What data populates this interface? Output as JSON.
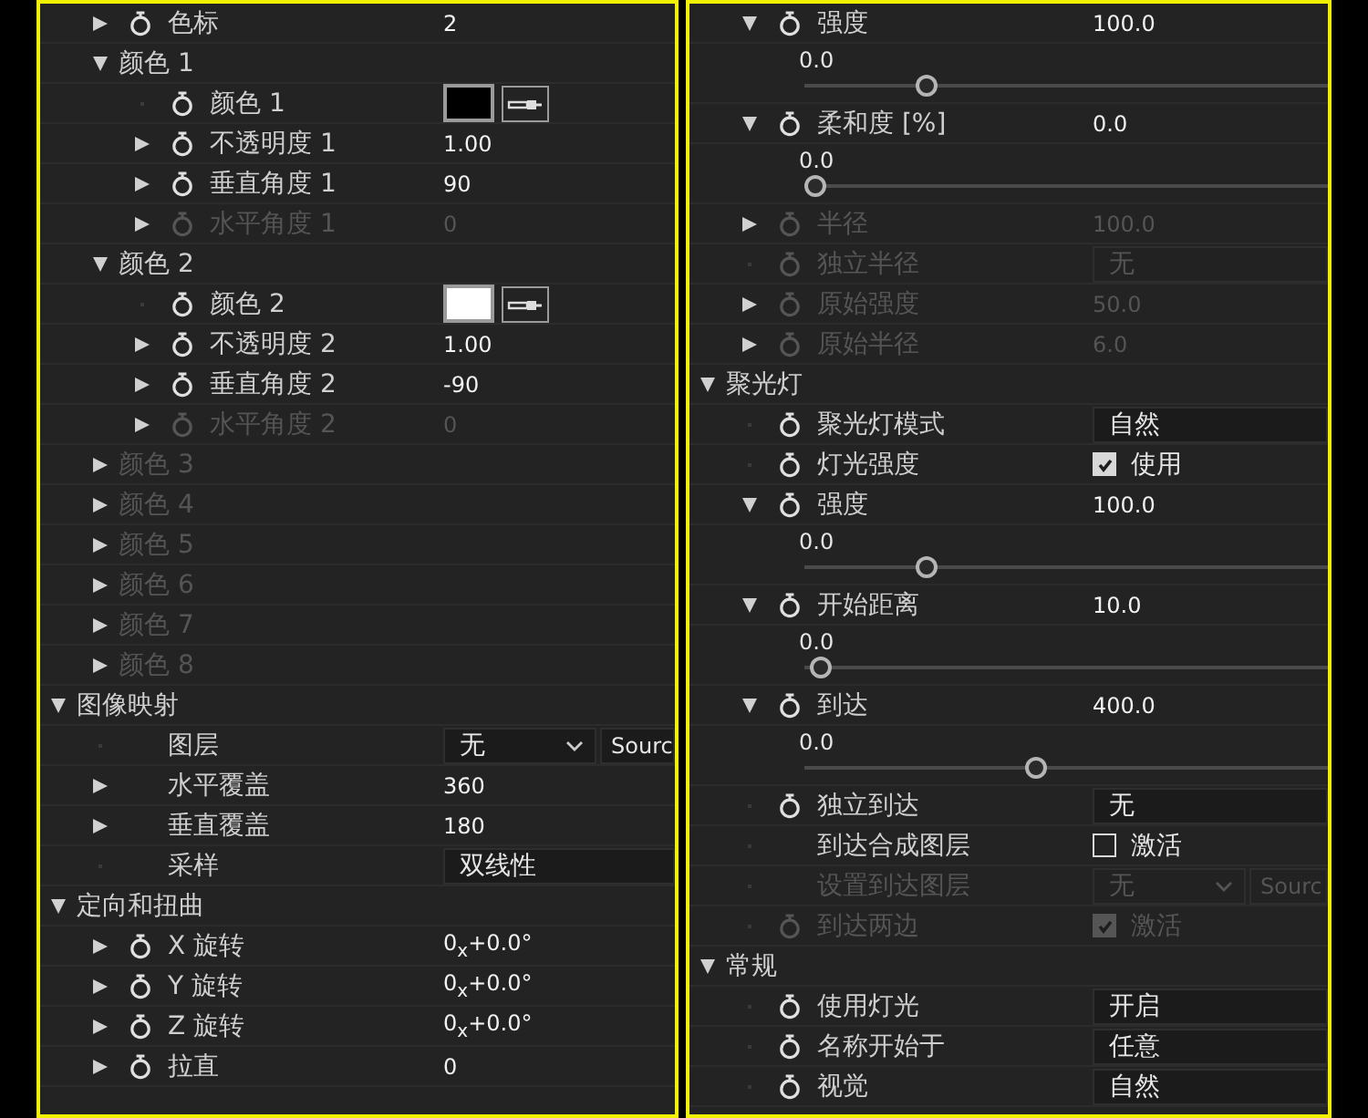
{
  "left": {
    "items": [
      {
        "children": [
          {
            "kind": "prop",
            "label": "色标",
            "value": "2",
            "stopwatch": true,
            "expanded": false,
            "disabled": false
          },
          {
            "kind": "group",
            "label": "颜色 1",
            "expanded": true,
            "disabled": false,
            "children": [
              {
                "kind": "color",
                "label": "颜色 1",
                "stopwatch": true,
                "color": "#000000",
                "disabled": false
              },
              {
                "kind": "prop",
                "label": "不透明度 1",
                "value": "1.00",
                "stopwatch": true,
                "expanded": false,
                "disabled": false
              },
              {
                "kind": "prop",
                "label": "垂直角度 1",
                "value": "90",
                "stopwatch": true,
                "expanded": false,
                "disabled": false
              },
              {
                "kind": "prop",
                "label": "水平角度 1",
                "value": "0",
                "stopwatch": true,
                "expanded": false,
                "disabled": true
              }
            ]
          },
          {
            "kind": "group",
            "label": "颜色 2",
            "expanded": true,
            "disabled": false,
            "children": [
              {
                "kind": "color",
                "label": "颜色 2",
                "stopwatch": true,
                "color": "#ffffff",
                "disabled": false
              },
              {
                "kind": "prop",
                "label": "不透明度 2",
                "value": "1.00",
                "stopwatch": true,
                "expanded": false,
                "disabled": false
              },
              {
                "kind": "prop",
                "label": "垂直角度 2",
                "value": "-90",
                "stopwatch": true,
                "expanded": false,
                "disabled": false
              },
              {
                "kind": "prop",
                "label": "水平角度 2",
                "value": "0",
                "stopwatch": true,
                "expanded": false,
                "disabled": true
              }
            ]
          },
          {
            "kind": "group",
            "label": "颜色 3",
            "expanded": false,
            "disabled": true
          },
          {
            "kind": "group",
            "label": "颜色 4",
            "expanded": false,
            "disabled": true
          },
          {
            "kind": "group",
            "label": "颜色 5",
            "expanded": false,
            "disabled": true
          },
          {
            "kind": "group",
            "label": "颜色 6",
            "expanded": false,
            "disabled": true
          },
          {
            "kind": "group",
            "label": "颜色 7",
            "expanded": false,
            "disabled": true
          },
          {
            "kind": "group",
            "label": "颜色 8",
            "expanded": false,
            "disabled": true
          }
        ]
      },
      {
        "kind": "group",
        "label": "图像映射",
        "expanded": true,
        "disabled": false,
        "children": [
          {
            "kind": "layer",
            "label": "图层",
            "value": "无",
            "source": "Sourc",
            "stopwatch": false,
            "disabled": false
          },
          {
            "kind": "prop",
            "label": "水平覆盖",
            "value": "360",
            "stopwatch": false,
            "expanded": false,
            "disabled": false
          },
          {
            "kind": "prop",
            "label": "垂直覆盖",
            "value": "180",
            "stopwatch": false,
            "expanded": false,
            "disabled": false
          },
          {
            "kind": "dropdown",
            "label": "采样",
            "value": "双线性",
            "stopwatch": false,
            "disabled": false
          }
        ]
      },
      {
        "kind": "group",
        "label": "定向和扭曲",
        "expanded": true,
        "disabled": false,
        "children": [
          {
            "kind": "prop",
            "label": "X 旋转",
            "value": "0$_{x}$+0.0°",
            "stopwatch": true,
            "expanded": false,
            "disabled": false
          },
          {
            "kind": "prop",
            "label": "Y 旋转",
            "value": "0$_{x}$+0.0°",
            "stopwatch": true,
            "expanded": false,
            "disabled": false
          },
          {
            "kind": "prop",
            "label": "Z 旋转",
            "value": "0$_{x}$+0.0°",
            "stopwatch": true,
            "expanded": false,
            "disabled": false
          },
          {
            "kind": "prop",
            "label": "拉直",
            "value": "0",
            "stopwatch": true,
            "expanded": false,
            "disabled": false
          }
        ]
      }
    ]
  },
  "right": {
    "items": [
      {
        "children": [
          {
            "kind": "prop",
            "label": "强度",
            "value": "100.0",
            "stopwatch": true,
            "expanded": true,
            "disabled": false,
            "children": [
              {
                "kind": "slider",
                "min": "0.0",
                "level": 0.22
              }
            ]
          },
          {
            "kind": "prop",
            "label": "柔和度 [%]",
            "value": "0.0",
            "stopwatch": true,
            "expanded": true,
            "disabled": false,
            "children": [
              {
                "kind": "slider",
                "min": "0.0",
                "level": 0
              }
            ]
          },
          {
            "kind": "prop",
            "label": "半径",
            "value": "100.0",
            "stopwatch": true,
            "expanded": false,
            "disabled": true
          },
          {
            "kind": "dropdown",
            "label": "独立半径",
            "value": "无",
            "stopwatch": true,
            "disabled": true
          },
          {
            "kind": "prop",
            "label": "原始强度",
            "value": "50.0",
            "stopwatch": true,
            "expanded": false,
            "disabled": true
          },
          {
            "kind": "prop",
            "label": "原始半径",
            "value": "6.0",
            "stopwatch": true,
            "expanded": false,
            "disabled": true
          }
        ]
      },
      {
        "kind": "group",
        "label": "聚光灯",
        "expanded": true,
        "disabled": false,
        "children": [
          {
            "kind": "dropdown",
            "label": "聚光灯模式",
            "value": "自然",
            "stopwatch": true,
            "disabled": false
          },
          {
            "kind": "checkbox",
            "label": "灯光强度",
            "value": "使用",
            "checked": true,
            "stopwatch": true,
            "disabled": false
          },
          {
            "kind": "prop",
            "label": "强度",
            "value": "100.0",
            "stopwatch": true,
            "expanded": true,
            "disabled": false,
            "children": [
              {
                "kind": "slider",
                "min": "0.0",
                "level": 0.22
              }
            ]
          },
          {
            "kind": "prop",
            "label": "开始距离",
            "value": "10.0",
            "stopwatch": true,
            "expanded": true,
            "disabled": false,
            "children": [
              {
                "kind": "slider",
                "min": "0.0",
                "level": 0.01
              }
            ]
          },
          {
            "kind": "prop",
            "label": "到达",
            "value": "400.0",
            "stopwatch": true,
            "expanded": true,
            "disabled": false,
            "children": [
              {
                "kind": "slider",
                "min": "0.0",
                "level": 0.44
              }
            ]
          },
          {
            "kind": "dropdown",
            "label": "独立到达",
            "value": "无",
            "stopwatch": true,
            "disabled": false
          },
          {
            "kind": "checkbox",
            "label": "到达合成图层",
            "value": "激活",
            "checked": false,
            "stopwatch": false,
            "disabled": false
          },
          {
            "kind": "layer",
            "label": "设置到达图层",
            "value": "无",
            "source": "Sourc",
            "stopwatch": false,
            "disabled": true
          },
          {
            "kind": "checkbox",
            "label": "到达两边",
            "value": "激活",
            "checked": true,
            "stopwatch": true,
            "disabled": true
          }
        ]
      },
      {
        "kind": "group",
        "label": "常规",
        "expanded": true,
        "disabled": false,
        "children": [
          {
            "kind": "dropdown",
            "label": "使用灯光",
            "value": "开启",
            "stopwatch": true,
            "disabled": false
          },
          {
            "kind": "dropdown",
            "label": "名称开始于",
            "value": "任意",
            "stopwatch": true,
            "disabled": false
          },
          {
            "kind": "dropdown",
            "label": "视觉",
            "value": "自然",
            "stopwatch": true,
            "disabled": false
          }
        ]
      }
    ]
  }
}
